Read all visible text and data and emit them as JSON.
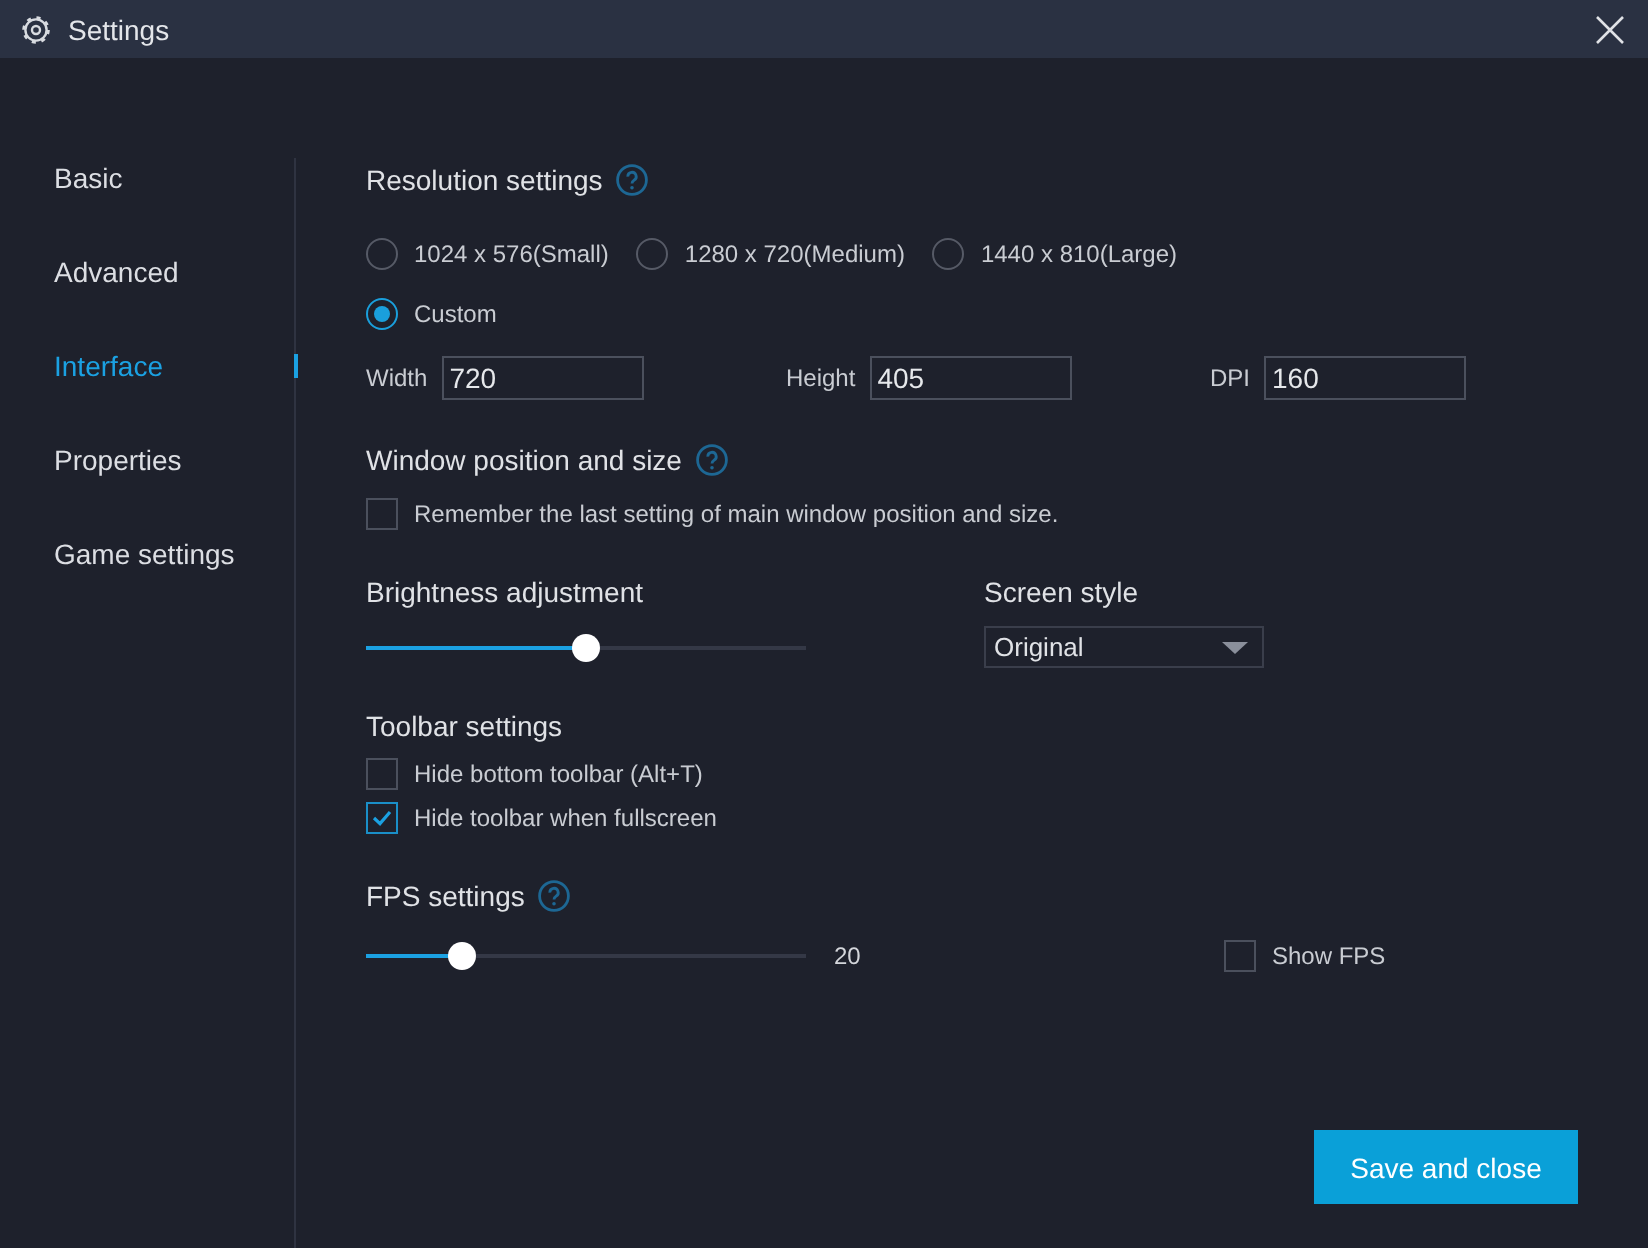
{
  "window": {
    "title": "Settings"
  },
  "sidebar": {
    "items": [
      {
        "label": "Basic",
        "selected": false
      },
      {
        "label": "Advanced",
        "selected": false
      },
      {
        "label": "Interface",
        "selected": true
      },
      {
        "label": "Properties",
        "selected": false
      },
      {
        "label": "Game settings",
        "selected": false
      }
    ]
  },
  "resolution": {
    "heading": "Resolution settings",
    "option_rows": [
      [
        {
          "label": "1024 x 576(Small)",
          "selected": false
        },
        {
          "label": "1280 x 720(Medium)",
          "selected": false
        },
        {
          "label": "1440 x 810(Large)",
          "selected": false
        }
      ],
      [
        {
          "label": "Custom",
          "selected": true
        }
      ]
    ],
    "fields": [
      {
        "label": "Width",
        "value": "720"
      },
      {
        "label": "Height",
        "value": "405"
      },
      {
        "label": "DPI",
        "value": "160"
      }
    ]
  },
  "window_position": {
    "heading": "Window position and size",
    "options": [
      {
        "label": "Remember the last setting of main window position and size.",
        "checked": false
      }
    ]
  },
  "brightness": {
    "heading": "Brightness adjustment",
    "level": 0.5
  },
  "screen_style": {
    "heading": "Screen style",
    "value": "Original"
  },
  "toolbar": {
    "heading": "Toolbar settings",
    "options": [
      {
        "label": "Hide bottom toolbar (Alt+T)",
        "checked": false
      },
      {
        "label": "Hide toolbar when fullscreen",
        "checked": true
      }
    ]
  },
  "fps": {
    "heading": "FPS settings",
    "level": 0.22,
    "reading": "20",
    "show_fps": {
      "label": "Show FPS",
      "checked": false
    }
  },
  "buttons": [
    "Save and close"
  ]
}
